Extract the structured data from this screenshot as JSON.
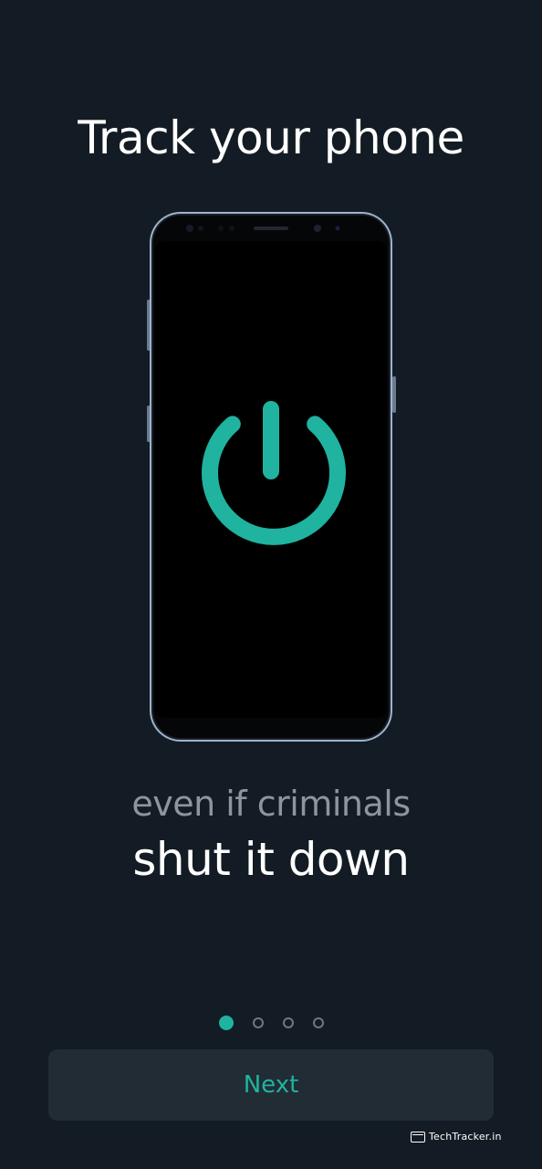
{
  "title": "Track your phone",
  "subtitle": "even if criminals",
  "headline": "shut it down",
  "pagination": {
    "total": 4,
    "active_index": 0
  },
  "next_button": {
    "label": "Next"
  },
  "watermark": {
    "text": "TechTracker.in"
  },
  "illustration": {
    "icon": "power-icon",
    "accent_color": "#1fb3a0"
  },
  "colors": {
    "background": "#131c24",
    "accent": "#1fb3a0",
    "button_background": "#222c35",
    "subtitle_text": "#8e959b"
  }
}
